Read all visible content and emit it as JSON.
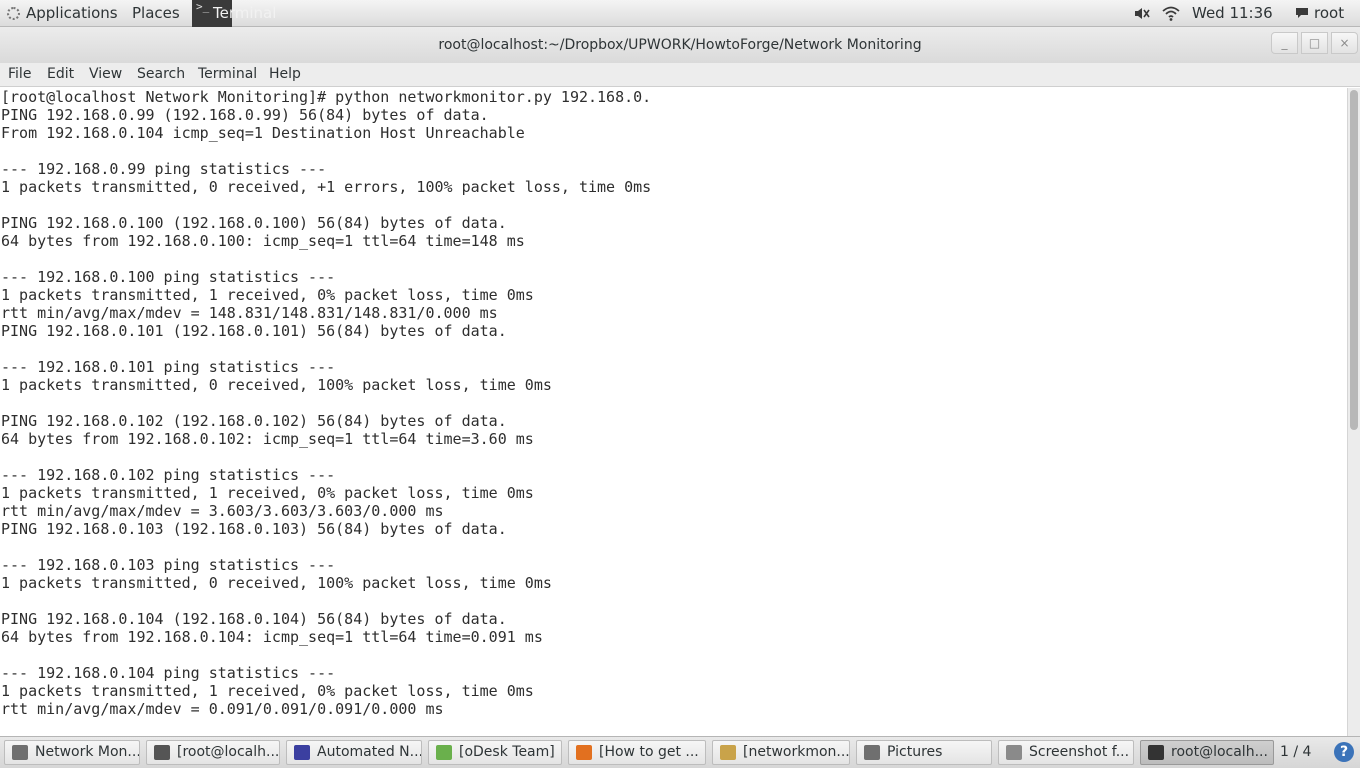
{
  "top_panel": {
    "applications_label": "Applications",
    "places_label": "Places",
    "terminal_label": "Terminal",
    "clock": "Wed 11:36",
    "user": "root"
  },
  "window": {
    "title": "root@localhost:~/Dropbox/UPWORK/HowtoForge/Network Monitoring",
    "minimize_glyph": "_",
    "maximize_glyph": "□",
    "close_glyph": "×"
  },
  "menubar": {
    "file": "File",
    "edit": "Edit",
    "view": "View",
    "search": "Search",
    "terminal": "Terminal",
    "help": "Help"
  },
  "terminal": {
    "lines": [
      "[root@localhost Network Monitoring]# python networkmonitor.py 192.168.0.",
      "PING 192.168.0.99 (192.168.0.99) 56(84) bytes of data.",
      "From 192.168.0.104 icmp_seq=1 Destination Host Unreachable",
      "",
      "--- 192.168.0.99 ping statistics ---",
      "1 packets transmitted, 0 received, +1 errors, 100% packet loss, time 0ms",
      "",
      "PING 192.168.0.100 (192.168.0.100) 56(84) bytes of data.",
      "64 bytes from 192.168.0.100: icmp_seq=1 ttl=64 time=148 ms",
      "",
      "--- 192.168.0.100 ping statistics ---",
      "1 packets transmitted, 1 received, 0% packet loss, time 0ms",
      "rtt min/avg/max/mdev = 148.831/148.831/148.831/0.000 ms",
      "PING 192.168.0.101 (192.168.0.101) 56(84) bytes of data.",
      "",
      "--- 192.168.0.101 ping statistics ---",
      "1 packets transmitted, 0 received, 100% packet loss, time 0ms",
      "",
      "PING 192.168.0.102 (192.168.0.102) 56(84) bytes of data.",
      "64 bytes from 192.168.0.102: icmp_seq=1 ttl=64 time=3.60 ms",
      "",
      "--- 192.168.0.102 ping statistics ---",
      "1 packets transmitted, 1 received, 0% packet loss, time 0ms",
      "rtt min/avg/max/mdev = 3.603/3.603/3.603/0.000 ms",
      "PING 192.168.0.103 (192.168.0.103) 56(84) bytes of data.",
      "",
      "--- 192.168.0.103 ping statistics ---",
      "1 packets transmitted, 0 received, 100% packet loss, time 0ms",
      "",
      "PING 192.168.0.104 (192.168.0.104) 56(84) bytes of data.",
      "64 bytes from 192.168.0.104: icmp_seq=1 ttl=64 time=0.091 ms",
      "",
      "--- 192.168.0.104 ping statistics ---",
      "1 packets transmitted, 1 received, 0% packet loss, time 0ms",
      "rtt min/avg/max/mdev = 0.091/0.091/0.091/0.000 ms"
    ]
  },
  "taskbar": {
    "tasks": [
      {
        "label": "Network Mon...",
        "icon": "folder-icon",
        "color": "#6f6f6f"
      },
      {
        "label": "[root@localh...",
        "icon": "terminal-icon",
        "color": "#555555"
      },
      {
        "label": "Automated N...",
        "icon": "eclipse-icon",
        "color": "#3b3fa0"
      },
      {
        "label": "[oDesk Team]",
        "icon": "chat-icon",
        "color": "#6ab04c"
      },
      {
        "label": "[How to get ...",
        "icon": "firefox-icon",
        "color": "#e2701f"
      },
      {
        "label": "[networkmon...",
        "icon": "text-editor-icon",
        "color": "#c9a34a"
      },
      {
        "label": "Pictures",
        "icon": "folder-icon",
        "color": "#6f6f6f"
      },
      {
        "label": "Screenshot f...",
        "icon": "screenshot-icon",
        "color": "#8a8a8a"
      },
      {
        "label": "root@localh...",
        "icon": "terminal-icon",
        "color": "#333333",
        "active": true
      }
    ],
    "workspace": "1 / 4",
    "help_glyph": "?"
  }
}
